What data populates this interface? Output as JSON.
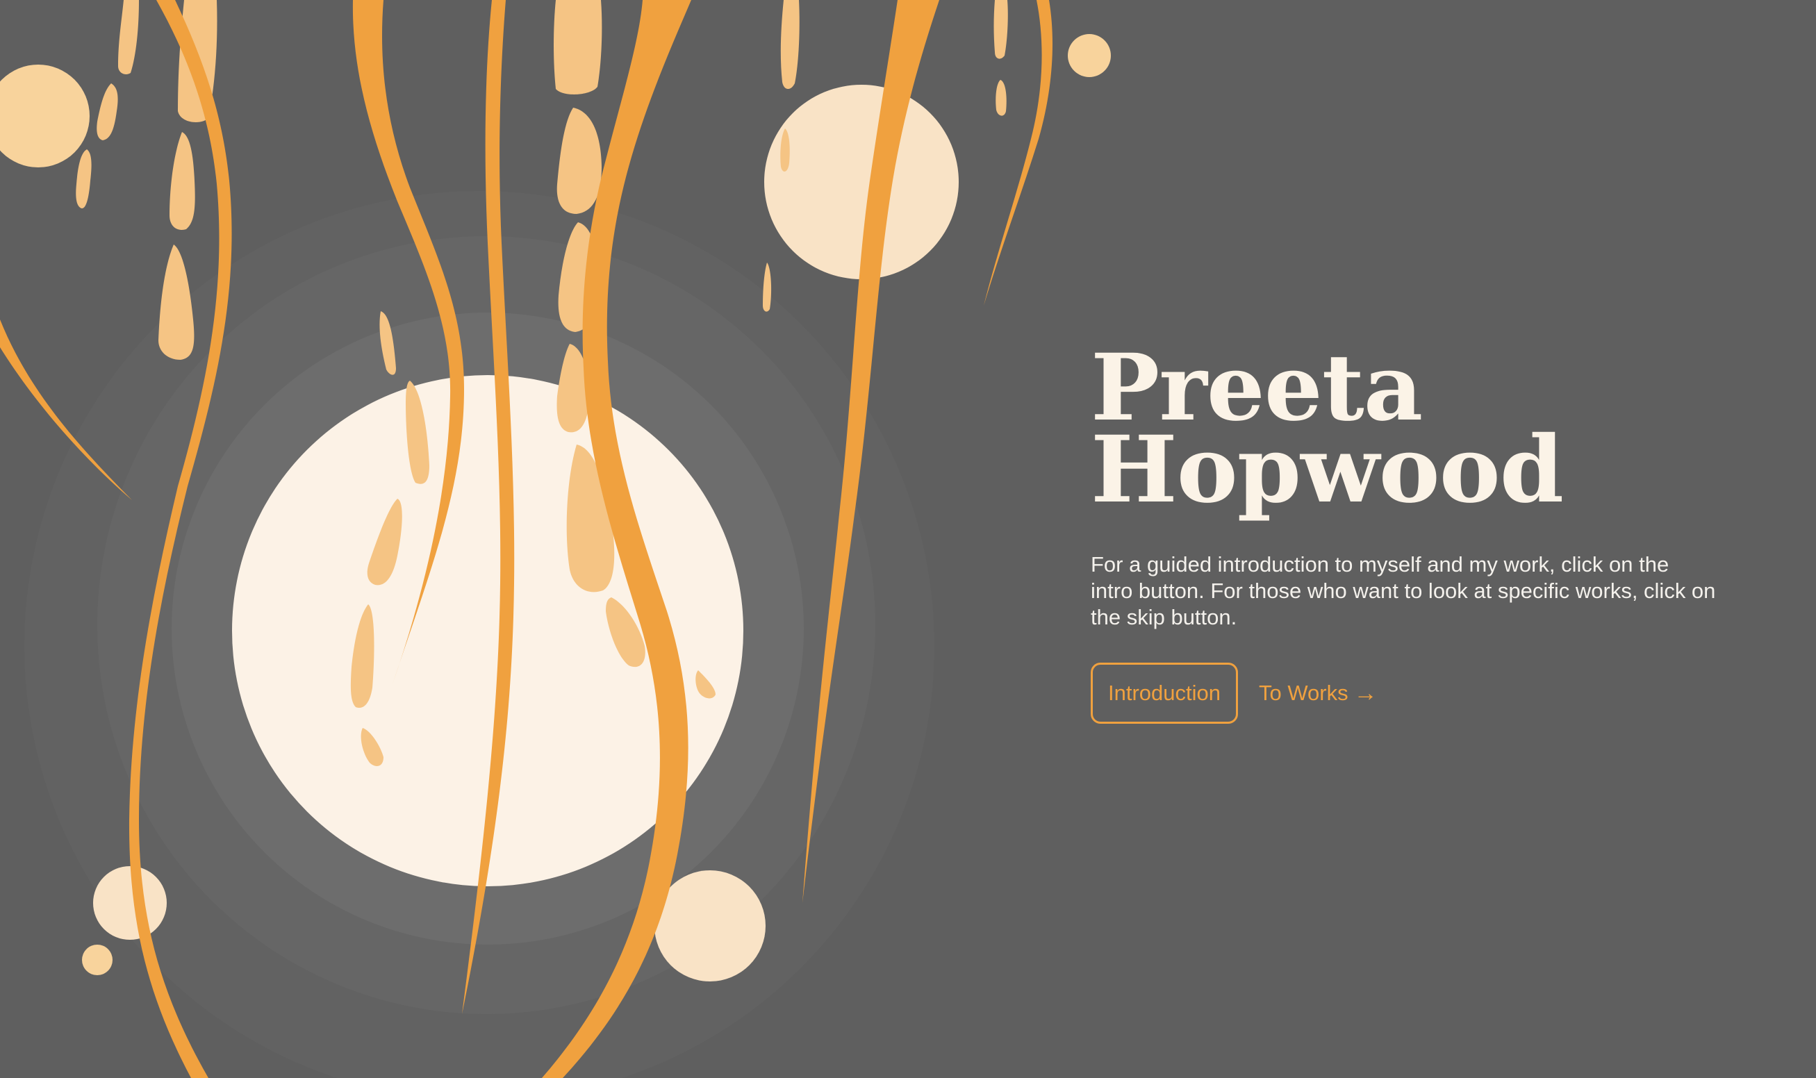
{
  "hero": {
    "title_line1": "Preeta",
    "title_line2": "Hopwood",
    "description": "For a guided introduction to myself and my work, click on the intro button. For those who want to look at specific works, click on the skip button."
  },
  "actions": {
    "intro_label": "Introduction",
    "works_label": "To Works",
    "works_arrow": "→"
  },
  "colors": {
    "background": "#5f5f5f",
    "accent": "#f0a13f",
    "cream": "#fcf2e6",
    "peach": "#f8d39c"
  },
  "icons": {
    "works_link_icon": "arrow-right-icon"
  }
}
